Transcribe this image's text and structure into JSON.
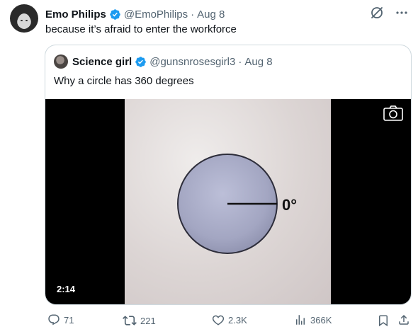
{
  "tweet": {
    "author_name": "Emo Philips",
    "handle": "@EmoPhilips",
    "separator": "·",
    "date": "Aug 8",
    "text": "because it’s afraid to enter the workforce"
  },
  "quote": {
    "author_name": "Science girl",
    "handle": "@gunsnrosesgirl3",
    "separator": "·",
    "date": "Aug 8",
    "text": "Why a circle has 360 degrees",
    "video": {
      "angle_label": "0°",
      "duration": "2:14"
    }
  },
  "actions": {
    "replies": "71",
    "retweets": "221",
    "likes": "2.3K",
    "views": "366K"
  },
  "colors": {
    "verified": "#1d9bf0",
    "text_primary": "#0f1419",
    "text_secondary": "#536471",
    "border": "#cfd9de",
    "circle_fill": "#a9abc6"
  },
  "icons": [
    "grok-icon",
    "more-icon",
    "verified-icon",
    "camera-icon",
    "reply-icon",
    "retweet-icon",
    "like-icon",
    "views-icon",
    "bookmark-icon",
    "share-icon"
  ]
}
